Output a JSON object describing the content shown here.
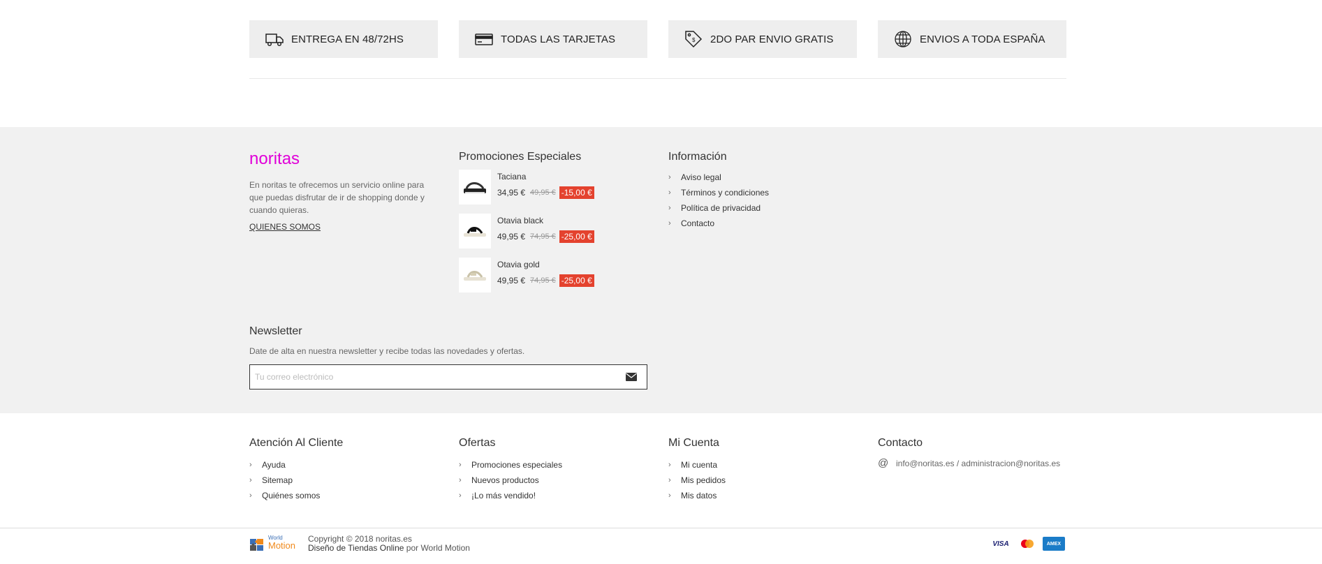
{
  "features": [
    {
      "icon": "truck-icon",
      "label": "ENTREGA EN 48/72HS"
    },
    {
      "icon": "credit-card-icon",
      "label": "TODAS LAS TARJETAS"
    },
    {
      "icon": "tag-icon",
      "label": "2DO PAR ENVIO GRATIS"
    },
    {
      "icon": "globe-icon",
      "label": "ENVIOS A TODA ESPAÑA"
    }
  ],
  "brand": {
    "logo": "noritas",
    "description": "En noritas te ofrecemos un servicio online para que puedas disfrutar de ir de shopping donde y cuando quieras.",
    "link": "QUIENES SOMOS"
  },
  "promos": {
    "title": "Promociones Especiales",
    "items": [
      {
        "name": "Taciana",
        "price": "34,95 €",
        "old_price": "49,95 €",
        "discount": "-15,00 €"
      },
      {
        "name": "Otavia black",
        "price": "49,95 €",
        "old_price": "74,95 €",
        "discount": "-25,00 €"
      },
      {
        "name": "Otavia gold",
        "price": "49,95 €",
        "old_price": "74,95 €",
        "discount": "-25,00 €"
      }
    ]
  },
  "info": {
    "title": "Información",
    "links": [
      "Aviso legal",
      "Términos y condiciones",
      "Política de privacidad",
      "Contacto"
    ]
  },
  "newsletter": {
    "title": "Newsletter",
    "text": "Date de alta en nuestra newsletter y recibe todas las novedades y ofertas.",
    "placeholder": "Tu correo electrónico",
    "button_icon": "envelope-icon"
  },
  "footer": {
    "atencion": {
      "title": "Atención Al Cliente",
      "links": [
        "Ayuda",
        "Sitemap",
        "Quiénes somos"
      ]
    },
    "ofertas": {
      "title": "Ofertas",
      "links": [
        "Promociones especiales",
        "Nuevos productos",
        "¡Lo más vendido!"
      ]
    },
    "cuenta": {
      "title": "Mi Cuenta",
      "links": [
        "Mi cuenta",
        "Mis pedidos",
        "Mis datos"
      ]
    },
    "contacto": {
      "title": "Contacto",
      "icon": "at-icon",
      "text": "info@noritas.es / administracion@noritas.es"
    }
  },
  "bottom": {
    "wm_top": "World",
    "wm_bottom": "Motion",
    "copyright": "Copyright © 2018 noritas.es",
    "design_link": "Diseño de Tiendas Online",
    "design_by": "por World Motion",
    "cards": [
      "VISA",
      "mastercard",
      "AMEX"
    ]
  },
  "colors": {
    "brand": "#e000d8",
    "discount": "#e4422e",
    "band": "#f1f1f1",
    "feature_bg": "#eeeeee"
  }
}
